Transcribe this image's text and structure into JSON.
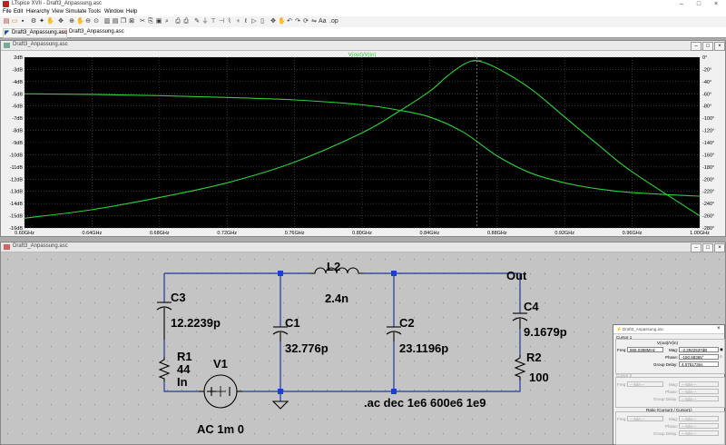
{
  "window": {
    "title": "LTspice XVII - Draft3_Anpassung.asc"
  },
  "menu": [
    "File",
    "Edit",
    "Hierarchy",
    "View",
    "Simulate",
    "Tools",
    "Window",
    "Help"
  ],
  "tabs": [
    {
      "label": "Draft3_Anpassung.asc"
    },
    {
      "label": "Draft3_Anpassung.asc"
    }
  ],
  "plot_window": {
    "title": "Draft3_Anpassung.asc",
    "trace_label": "V(out)/V(in)"
  },
  "chart_data": {
    "type": "line",
    "title": "V(out)/V(in)",
    "x_ticks": [
      "0.60GHz",
      "0.64GHz",
      "0.68GHz",
      "0.72GHz",
      "0.76GHz",
      "0.80GHz",
      "0.84GHz",
      "0.88GHz",
      "0.92GHz",
      "0.96GHz",
      "1.00GHz"
    ],
    "y_left_ticks": [
      "2dB",
      "-3dB",
      "-4dB",
      "-5dB",
      "-6dB",
      "-7dB",
      "-8dB",
      "-9dB",
      "-10dB",
      "-11dB",
      "-12dB",
      "-13dB",
      "-14dB",
      "-15dB",
      "-16dB"
    ],
    "y_right_ticks": [
      "0°",
      "-20°",
      "-40°",
      "-60°",
      "-80°",
      "-100°",
      "-120°",
      "-140°",
      "-160°",
      "-180°",
      "-200°",
      "-220°",
      "-240°",
      "-260°",
      "-280°"
    ],
    "xlim": [
      0.6,
      1.0
    ],
    "y_left_lim": [
      -16,
      -2
    ],
    "y_right_lim": [
      -280,
      0
    ],
    "grid": true,
    "cursor_x": 0.868,
    "series": [
      {
        "name": "magnitude",
        "axis": "left",
        "x": [
          0.6,
          0.64,
          0.68,
          0.72,
          0.76,
          0.8,
          0.82,
          0.84,
          0.85,
          0.86,
          0.868,
          0.88,
          0.9,
          0.92,
          0.94,
          0.96,
          1.0
        ],
        "y": [
          -15.2,
          -14.5,
          -13.5,
          -12.3,
          -10.6,
          -8.2,
          -6.6,
          -4.8,
          -3.6,
          -2.6,
          -2.29,
          -2.9,
          -4.6,
          -6.9,
          -9.2,
          -11.4,
          -15.0
        ]
      },
      {
        "name": "phase",
        "axis": "right",
        "x": [
          0.6,
          0.64,
          0.68,
          0.72,
          0.76,
          0.8,
          0.82,
          0.84,
          0.86,
          0.88,
          0.9,
          0.92,
          0.94,
          0.96,
          1.0
        ],
        "y": [
          -60,
          -61,
          -63,
          -66,
          -70,
          -78,
          -86,
          -98,
          -123,
          -162,
          -190,
          -206,
          -216,
          -222,
          -228
        ]
      }
    ]
  },
  "schematic": {
    "title": "Draft3_Anpassung.asc",
    "components": {
      "L2": {
        "name": "L2",
        "value": "2.4n"
      },
      "C3": {
        "name": "C3",
        "value": "12.2239p"
      },
      "C1": {
        "name": "C1",
        "value": "32.776p"
      },
      "C2": {
        "name": "C2",
        "value": "23.1196p"
      },
      "C4": {
        "name": "C4",
        "value": "9.1679p"
      },
      "R1": {
        "name": "R1",
        "value": "44",
        "extra": "In"
      },
      "R2": {
        "name": "R2",
        "value": "100"
      },
      "V1": {
        "name": "V1",
        "value": "AC 1m 0"
      }
    },
    "net_label": "Out",
    "directive": ".ac dec 1e6 600e6 1e9"
  },
  "cursor_dialog": {
    "title": "Draft3_Anpassung.asc",
    "cursor1": {
      "group": "Cursor 1",
      "trace": "V(out)/V(in)",
      "freq_label": "Freq:",
      "freq": "868.0398MHz",
      "mag_label": "Mag:",
      "mag": "-2.2922537dB",
      "phase_label": "Phase:",
      "phase": "-150.68365°",
      "gd_label": "Group Delay:",
      "gd": "4.075173ns"
    },
    "cursor2": {
      "group": "Cursor 2",
      "freq_label": "Freq:",
      "freq": "---N/A---",
      "mag_label": "Mag:",
      "mag": "---N/A---",
      "phase_label": "Phase:",
      "phase": "---N/A---",
      "gd_label": "Group Delay:",
      "gd": "---N/A---"
    },
    "ratio": {
      "group": "Ratio (Cursor2 / Cursor1)",
      "freq_label": "Freq:",
      "freq": "---N/A---",
      "mag_label": "Mag:",
      "mag": "---N/A---",
      "phase_label": "Phase:",
      "phase": "---N/A---",
      "gd_label": "Group Delay:",
      "gd": "---N/A---"
    }
  },
  "colors": {
    "plot_bg": "#000000",
    "trace": "#2ecf3c",
    "grid": "#5a5a5a",
    "schematic_bg": "#c4c4c4",
    "wire": "#1e3a9a",
    "node": "#1b3fd0"
  }
}
